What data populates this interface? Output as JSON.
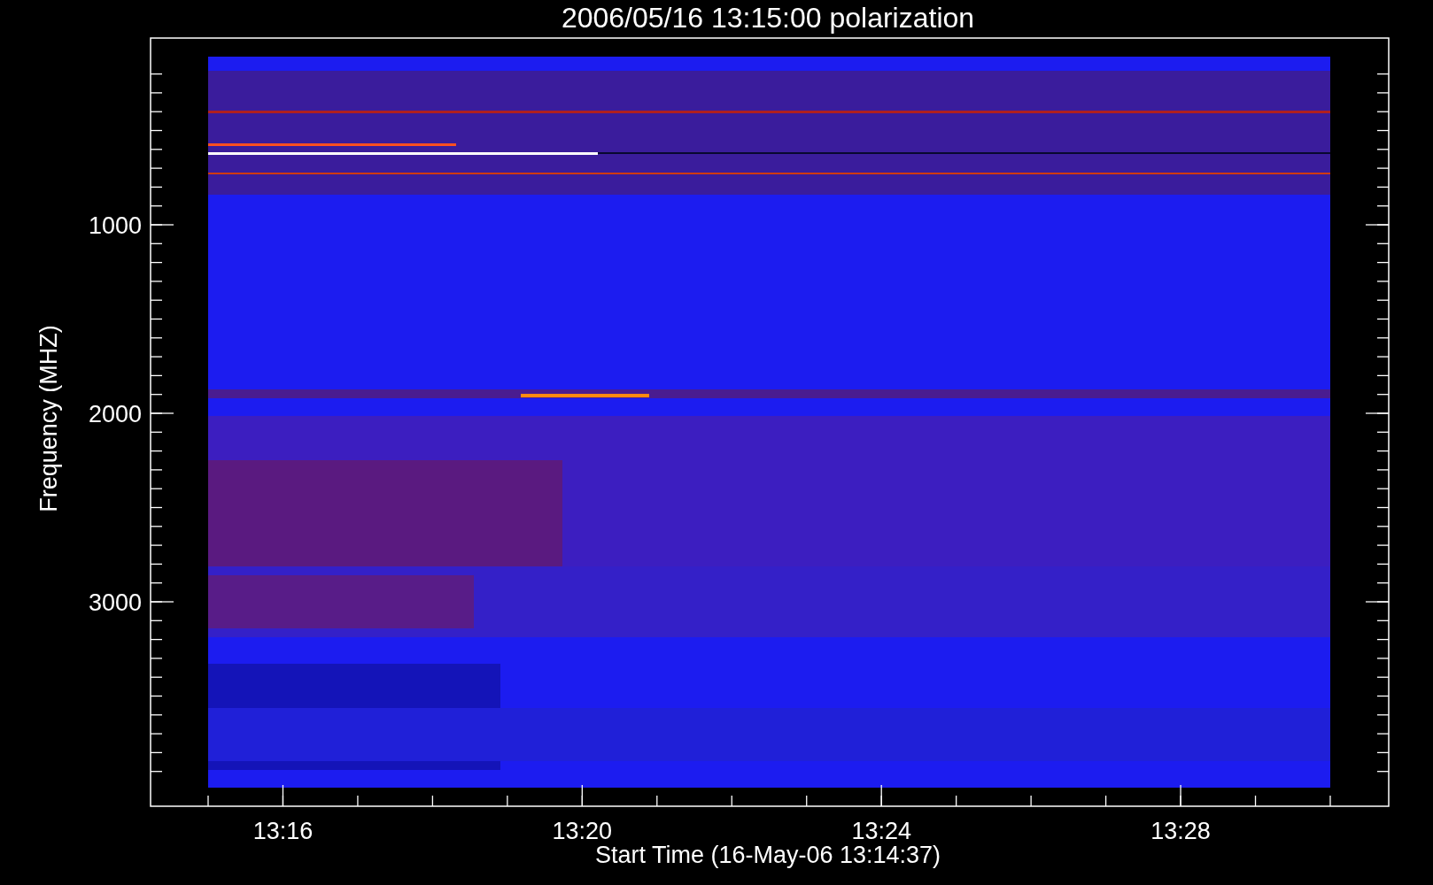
{
  "plot": {
    "title": "2006/05/16 13:15:00 polarization",
    "xlabel": "Start Time (16-May-06 13:14:37)",
    "ylabel": "Frequency (MHZ)",
    "x_tick_labels": [
      "13:16",
      "13:20",
      "13:24",
      "13:28"
    ],
    "y_tick_labels": [
      "1000",
      "2000",
      "3000"
    ]
  }
}
